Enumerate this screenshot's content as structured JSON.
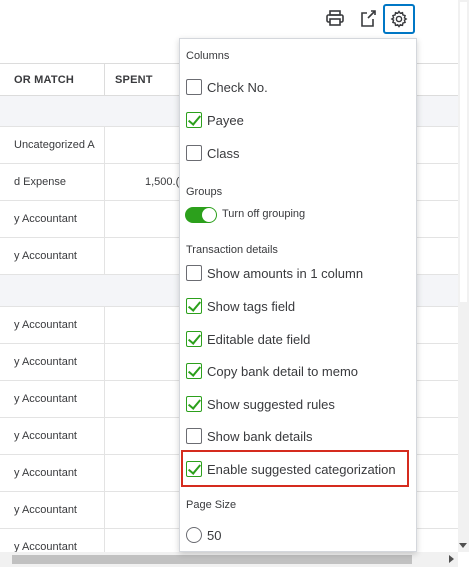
{
  "toolbar": {
    "print_icon": "printer-icon",
    "export_icon": "export-icon",
    "settings_icon": "gear-icon"
  },
  "table": {
    "headers": [
      "OR MATCH",
      "SPENT"
    ],
    "rows": [
      {
        "match": "Uncategorized A",
        "spent": ""
      },
      {
        "match": "d Expense",
        "spent": "1,500.("
      },
      {
        "match": "y Accountant",
        "spent": ""
      },
      {
        "match": "y Accountant",
        "spent": ""
      },
      {
        "match": "y Accountant",
        "spent": ""
      },
      {
        "match": "y Accountant",
        "spent": ""
      },
      {
        "match": "y Accountant",
        "spent": ""
      },
      {
        "match": "y Accountant",
        "spent": ""
      },
      {
        "match": "y Accountant",
        "spent": ""
      },
      {
        "match": "y Accountant",
        "spent": ""
      },
      {
        "match": "y Accountant",
        "spent": ""
      }
    ]
  },
  "settings": {
    "columns_heading": "Columns",
    "columns": [
      {
        "label": "Check No.",
        "checked": false
      },
      {
        "label": "Payee",
        "checked": true
      },
      {
        "label": "Class",
        "checked": false
      }
    ],
    "groups_heading": "Groups",
    "grouping_toggle": {
      "label": "Turn off grouping",
      "on": true
    },
    "transaction_heading": "Transaction details",
    "transaction_details": [
      {
        "label": "Show amounts in 1 column",
        "checked": false
      },
      {
        "label": "Show tags field",
        "checked": true
      },
      {
        "label": "Editable date field",
        "checked": true
      },
      {
        "label": "Copy bank detail to memo",
        "checked": true
      },
      {
        "label": "Show suggested rules",
        "checked": true
      },
      {
        "label": "Show bank details",
        "checked": false
      },
      {
        "label": "Enable suggested categorization",
        "checked": true
      }
    ],
    "page_size_heading": "Page Size",
    "page_size_options": [
      {
        "label": "50",
        "selected": false
      }
    ]
  },
  "colors": {
    "accent_blue": "#0077c5",
    "check_green": "#2ca01c",
    "highlight_red": "#d52b1e"
  }
}
